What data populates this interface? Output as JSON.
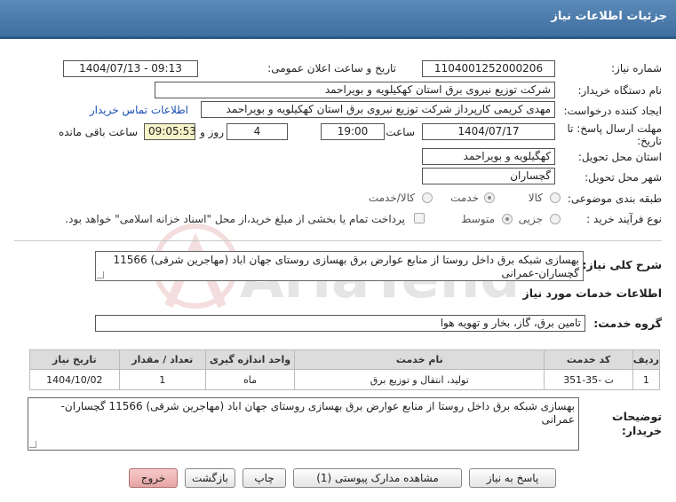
{
  "header": {
    "title": "جزئیات اطلاعات نیاز"
  },
  "form": {
    "need_number": {
      "label": "شماره نیاز:",
      "value": "1104001252000206"
    },
    "announce_datetime": {
      "label": "تاریخ و ساعت اعلان عمومی:",
      "value": "1404/07/13 - 09:13"
    },
    "buyer_org": {
      "label": "نام دستگاه خریدار:",
      "value": "شرکت توزیع نیروی برق استان کهکیلویه و بویراحمد"
    },
    "requester": {
      "label": "ایجاد کننده درخواست:",
      "value": "مهدی کریمی کارپرداز شرکت توزیع نیروی برق استان کهکیلویه و بویراحمد"
    },
    "contact_link": "اطلاعات تماس خریدار",
    "deadline": {
      "label_line1": "مهلت ارسال پاسخ: تا",
      "label_line2": "تاریخ:",
      "date": "1404/07/17",
      "time_label": "ساعت",
      "time": "19:00",
      "days": "4",
      "days_label": "روز و",
      "remaining": "09:05:53",
      "remaining_label": "ساعت باقی مانده"
    },
    "province": {
      "label": "استان محل تحویل:",
      "value": "کهگیلویه و بویراحمد"
    },
    "city": {
      "label": "شهر محل تحویل:",
      "value": "گچساران"
    },
    "category": {
      "label": "طبقه بندی موضوعی:",
      "options": [
        "کالا",
        "خدمت",
        "کالا/خدمت"
      ],
      "selected": "خدمت"
    },
    "purchase_type": {
      "label": "نوع فرآیند خرید :",
      "options": [
        "جزیی",
        "متوسط"
      ],
      "selected": "متوسط",
      "payment_note": "پرداخت تمام یا بخشی از مبلغ خرید،از محل \"اسناد خزانه اسلامی\" خواهد بود."
    }
  },
  "summary": {
    "label": "شرح کلی نیاز:",
    "value": "بهسازی شبکه برق داخل روستا از منابع عوارض برق بهسازی روستای جهان اباد (مهاجرین شرقی) 11566 گچساران-عمرانی"
  },
  "services": {
    "section_title": "اطلاعات خدمات مورد نیاز",
    "group_label": "گروه خدمت:",
    "group_value": "تامین برق، گاز، بخار و تهویه هوا",
    "table": {
      "headers": [
        "ردیف",
        "کد خدمت",
        "نام خدمت",
        "واحد اندازه گیری",
        "تعداد / مقدار",
        "تاریخ نیاز"
      ],
      "rows": [
        [
          "1",
          "ت -35-351",
          "تولید، انتقال و توزیع برق",
          "ماه",
          "1",
          "1404/10/02"
        ]
      ]
    }
  },
  "buyer_notes": {
    "label_line1": "توضیحات",
    "label_line2": "خریدار:",
    "value": "بهسازی شبکه برق داخل روستا از منابع عوارض برق بهسازی روستای جهان اباد (مهاجرین شرقی) 11566 گچساران-عمرانی"
  },
  "buttons": {
    "reply": "پاسخ به نیاز",
    "attachments": "مشاهده مدارک پیوستی (1)",
    "print": "چاپ",
    "back": "بازگشت",
    "exit": "خروج"
  },
  "watermark": "AriaTender.net",
  "colors": {
    "header": "#4a7aab",
    "link": "#1a4fb0",
    "exit_button": "#e7a5a5",
    "remaining_field": "#f7f2c8"
  }
}
